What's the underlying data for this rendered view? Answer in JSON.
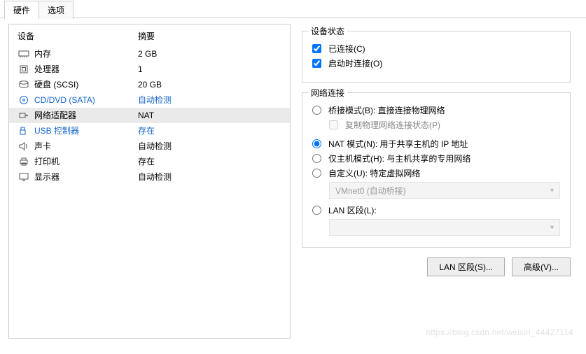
{
  "tabs": {
    "hardware": "硬件",
    "options": "选项"
  },
  "headers": {
    "device": "设备",
    "summary": "摘要"
  },
  "devices": [
    {
      "id": "memory",
      "label": "内存",
      "summary": "2 GB"
    },
    {
      "id": "cpu",
      "label": "处理器",
      "summary": "1"
    },
    {
      "id": "disk",
      "label": "硬盘 (SCSI)",
      "summary": "20 GB"
    },
    {
      "id": "cd",
      "label": "CD/DVD (SATA)",
      "summary": "自动检测",
      "link": true
    },
    {
      "id": "net",
      "label": "网络适配器",
      "summary": "NAT",
      "selected": true
    },
    {
      "id": "usb",
      "label": "USB 控制器",
      "summary": "存在",
      "link": true
    },
    {
      "id": "sound",
      "label": "声卡",
      "summary": "自动检测"
    },
    {
      "id": "printer",
      "label": "打印机",
      "summary": "存在"
    },
    {
      "id": "display",
      "label": "显示器",
      "summary": "自动检测"
    }
  ],
  "groups": {
    "status": {
      "title": "设备状态",
      "connected_label": "已连接(C)",
      "connect_at_boot_label": "启动时连接(O)",
      "connected": true,
      "connect_at_boot": true
    },
    "network": {
      "title": "网络连接",
      "bridged_label": "桥接模式(B): 直接连接物理网络",
      "replicate_label": "复制物理网络连接状态(P)",
      "nat_label": "NAT 模式(N): 用于共享主机的 IP 地址",
      "hostonly_label": "仅主机模式(H): 与主机共享的专用网络",
      "custom_label": "自定义(U): 特定虚拟网络",
      "custom_combo": "VMnet0 (自动桥接)",
      "lan_label": "LAN 区段(L):",
      "lan_combo": "",
      "selected": "nat"
    }
  },
  "buttons": {
    "lan_segments": "LAN 区段(S)...",
    "advanced": "高级(V)..."
  },
  "watermark": "https://blog.csdn.net/weixin_44427114"
}
